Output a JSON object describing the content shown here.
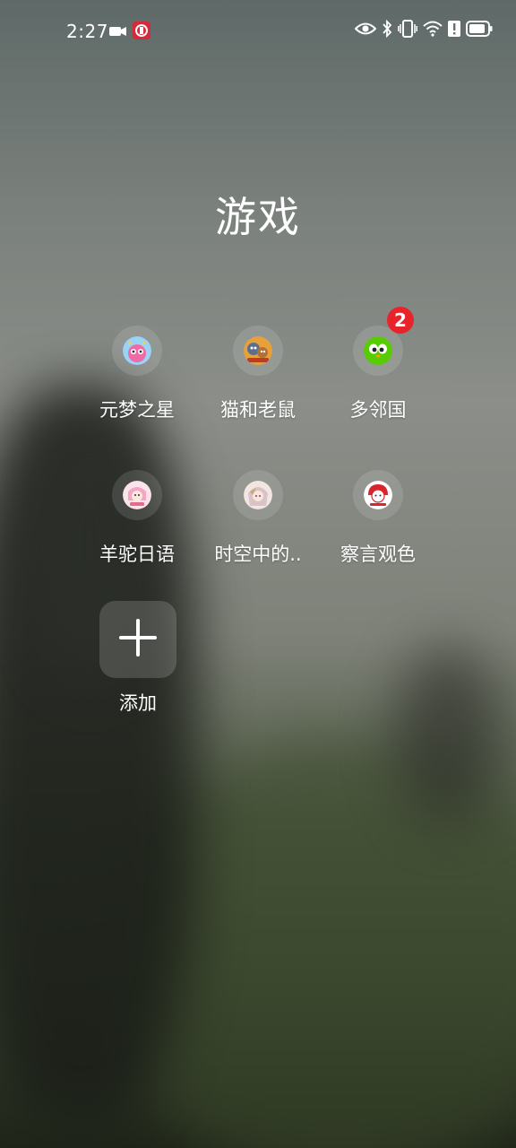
{
  "status_bar": {
    "time": "2:27",
    "left_icons": [
      "video-camera-icon",
      "app-notification-icon"
    ],
    "right_icons": [
      "eye-icon",
      "bluetooth-icon",
      "vibrate-icon",
      "wifi-icon",
      "alert-icon",
      "battery-icon"
    ]
  },
  "folder": {
    "title": "游戏",
    "apps": [
      {
        "label": "元梦之星",
        "icon": "yuanmeng-icon",
        "badge": ""
      },
      {
        "label": "猫和老鼠",
        "icon": "tom-jerry-icon",
        "badge": ""
      },
      {
        "label": "多邻国",
        "icon": "duolingo-icon",
        "badge": "2"
      },
      {
        "label": "羊驼日语",
        "icon": "alpaca-japanese-icon",
        "badge": ""
      },
      {
        "label": "时空中的..",
        "icon": "time-space-icon",
        "badge": ""
      },
      {
        "label": "察言观色",
        "icon": "observe-icon",
        "badge": ""
      }
    ],
    "add_label": "添加"
  },
  "colors": {
    "badge": "#e8242b",
    "duolingo_green": "#58cc02"
  }
}
